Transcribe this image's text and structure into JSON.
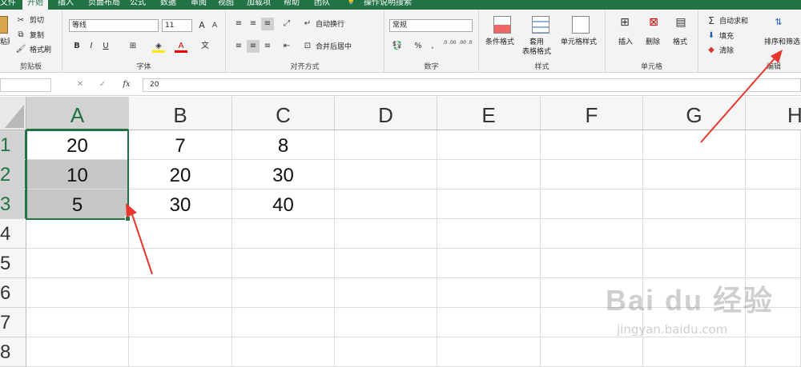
{
  "tabs": [
    "文件",
    "开始",
    "插入",
    "页面布局",
    "公式",
    "数据",
    "审阅",
    "视图",
    "加载项",
    "帮助",
    "团队",
    "操作说明搜索"
  ],
  "clipboard": {
    "paste": "粘贴",
    "cut": "剪切",
    "copy": "复制",
    "format_painter": "格式刷",
    "group": "剪贴板"
  },
  "font": {
    "name": "等线",
    "size": "11",
    "group": "字体",
    "grow": "A",
    "shrink": "A",
    "bold": "B",
    "italic": "I",
    "underline": "U",
    "color_letter": "A"
  },
  "align": {
    "wrap": "自动换行",
    "merge": "合并后居中",
    "group": "对齐方式"
  },
  "number": {
    "format": "常规",
    "percent": "%",
    "comma": ",",
    "inc_decimal": ".0 .00",
    "dec_decimal": ".00 .0",
    "group": "数字"
  },
  "styles": {
    "conditional": "条件格式",
    "table": "套用\n表格格式",
    "cell": "单元格样式",
    "group": "样式"
  },
  "cells": {
    "insert": "插入",
    "delete": "删除",
    "format": "格式",
    "group": "单元格"
  },
  "editing": {
    "autosum": "自动求和",
    "fill": "填充",
    "clear": "清除",
    "sort": "排序和筛选",
    "group": "编辑"
  },
  "formula_bar": {
    "name_box": "",
    "fx": "fx",
    "value": "20"
  },
  "columns": [
    "A",
    "B",
    "C",
    "D",
    "E",
    "F",
    "G",
    "H"
  ],
  "rows": [
    "1",
    "2",
    "3",
    "4",
    "5",
    "6",
    "7",
    "8"
  ],
  "cells_data": [
    [
      "20",
      "7",
      "8"
    ],
    [
      "10",
      "20",
      "30"
    ],
    [
      "5",
      "30",
      "40"
    ]
  ],
  "watermark": {
    "brand": "Bai du 经验",
    "url": "jingyan.baidu.com"
  },
  "colors": {
    "accent": "#217346",
    "arrow": "#e8372f"
  }
}
